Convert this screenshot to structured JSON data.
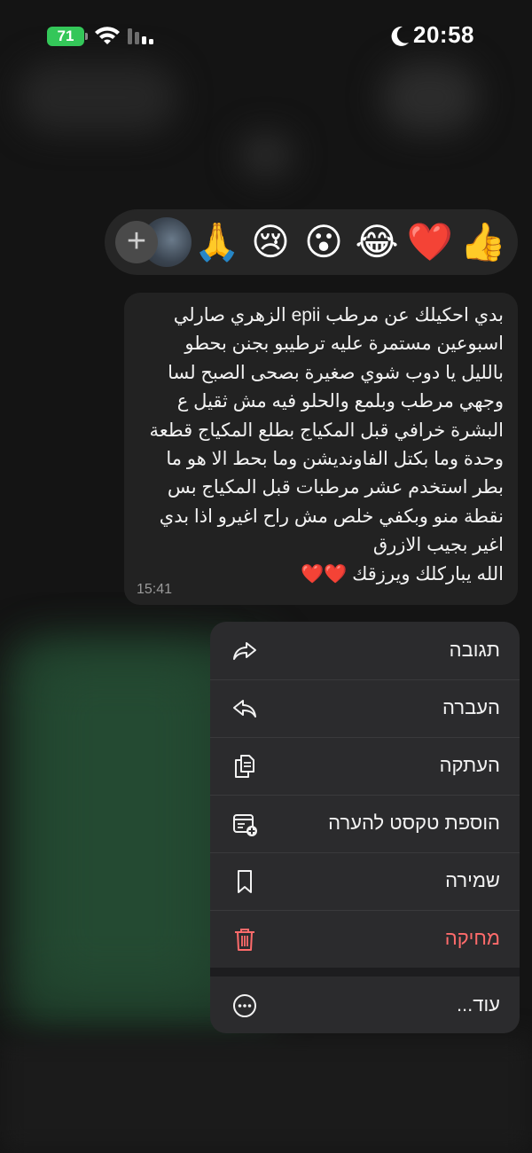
{
  "status_bar": {
    "battery": "71",
    "time": "20:58"
  },
  "reactions": {
    "add_label": "+",
    "emojis": [
      "🙏",
      "😢",
      "😮",
      "😂",
      "❤️",
      "👍"
    ]
  },
  "message": {
    "text": "بدي احكيلك عن مرطب epii الزهري صارلي\nاسبوعين مستمرة عليه ترطيبو بجنن بحطو\nبالليل يا دوب شوي صغيرة بصحى الصبح لسا\nوجهي مرطب وبلمع والحلو فيه مش ثقيل ع\nالبشرة خرافي قبل المكياج بطلع المكياج قطعة\nوحدة وما بكتل الفاونديشن وما بحط الا هو ما\nبطر استخدم عشر مرطبات قبل المكياج بس\nنقطة منو وبكفي خلص  مش راح اغيرو اذا بدي\nاغير بجيب الازرق\nالله يباركلك ويرزقك ❤️❤️",
    "time": "15:41"
  },
  "menu": {
    "items": [
      {
        "label": "תגובה",
        "icon": "reply-arrow-icon"
      },
      {
        "label": "העברה",
        "icon": "forward-arrow-icon"
      },
      {
        "label": "העתקה",
        "icon": "copy-icon"
      },
      {
        "label": "הוספת טקסט להערה",
        "icon": "add-note-icon"
      },
      {
        "label": "שמירה",
        "icon": "bookmark-icon"
      },
      {
        "label": "מחיקה",
        "icon": "trash-icon",
        "color": "#ff6b6b"
      },
      {
        "label": "עוד...",
        "icon": "more-icon"
      }
    ]
  },
  "colors": {
    "battery": "#34c759",
    "danger": "#ff6b6b",
    "menu_bg": "#2b2b2d",
    "bubble_bg": "#222222"
  }
}
